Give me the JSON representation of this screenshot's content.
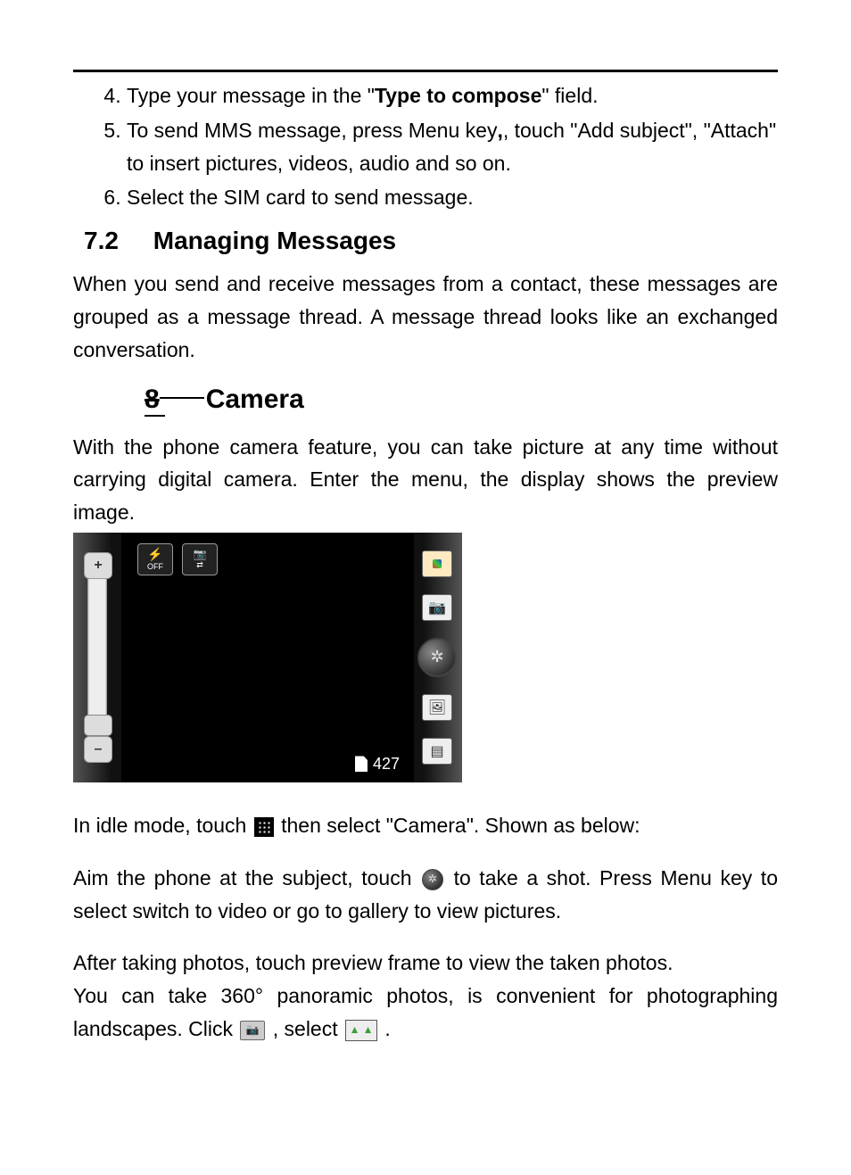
{
  "steps": {
    "item4_prefix": "Type your message in the \"",
    "item4_bold": "Type to compose",
    "item4_suffix": "\" field.",
    "item5_a": "To send MMS message, press Menu key",
    "item5_b": ", touch \"Add subject\", \"Attach\" to insert pictures, videos, audio and so on.",
    "item6": "Select the SIM card to send message."
  },
  "section72": {
    "num": "7.2",
    "title": "Managing Messages",
    "para": "When you send and receive messages from a contact, these messages are grouped as a message thread. A message thread looks like an exchanged conversation."
  },
  "section8": {
    "num": "8",
    "title": "Camera",
    "intro": "With the phone camera feature, you can take picture at any time without carrying digital camera. Enter the menu, the display shows the preview image."
  },
  "camera_ui": {
    "flash_label": "OFF",
    "switch_label": "⇄",
    "shutter_glyph": "✲",
    "shot_counter": "427",
    "zoom_plus": "+",
    "zoom_minus": "–"
  },
  "after": {
    "line1_a": "In idle mode, touch",
    "line1_b": " then select \"Camera\". Shown as below:",
    "line2_a": "Aim the phone at the subject, touch",
    "line2_b": " to take a shot. Press Menu key to select switch to video or go to gallery to view pictures.",
    "line3": "After taking photos, touch preview frame to view the taken photos.",
    "line4_a": "You can take 360° panoramic photos, is convenient for photographing landscapes. Click ",
    "line4_b": ", select ",
    "line4_c": "."
  },
  "icons": {
    "apps": "apps-grid-icon",
    "shutter": "shutter-icon",
    "camera_mode": "camera-mode-icon",
    "panorama": "panorama-icon"
  }
}
